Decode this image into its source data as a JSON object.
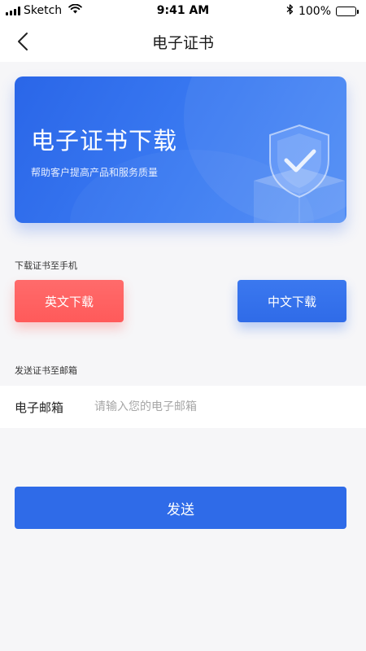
{
  "status_bar": {
    "carrier": "Sketch",
    "time": "9:41 AM",
    "battery": "100%",
    "battery_level": 1.0
  },
  "nav": {
    "title": "电子证书",
    "back_icon": "chevron-left-icon"
  },
  "banner": {
    "title": "电子证书下载",
    "subtitle": "帮助客户提高产品和服务质量",
    "icon": "shield-check-icon"
  },
  "download": {
    "label": "下载证书至手机",
    "english_button": "英文下载",
    "chinese_button": "中文下载"
  },
  "email": {
    "section_label": "发送证书至邮箱",
    "field_label": "电子邮箱",
    "placeholder": "请输入您的电子邮箱",
    "value": ""
  },
  "send_button": "发送",
  "colors": {
    "primary": "#2f6be8",
    "danger": "#ff5a5a",
    "background": "#f6f6f8"
  }
}
